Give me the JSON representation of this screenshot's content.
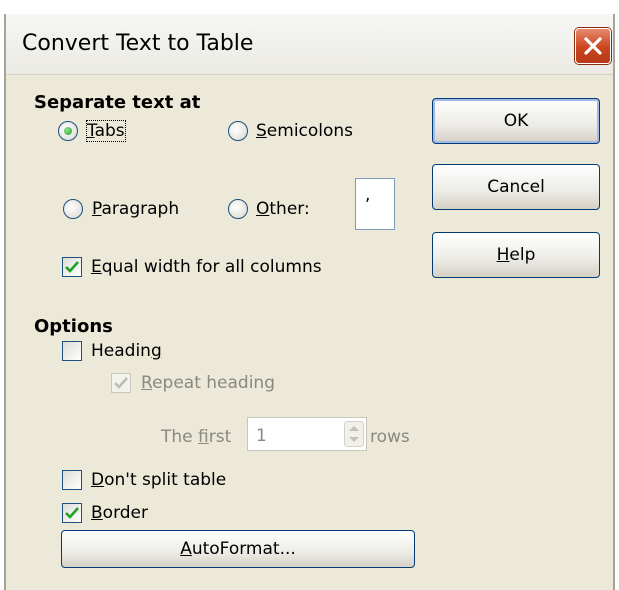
{
  "dialog": {
    "title": "Convert Text to Table"
  },
  "separate": {
    "group_title": "Separate text at",
    "tabs": {
      "label": "Tabs",
      "selected": true
    },
    "semicolons": {
      "label": "Semicolons",
      "selected": false
    },
    "paragraph": {
      "label": "Paragraph",
      "selected": false
    },
    "other": {
      "label": "Other:",
      "selected": false,
      "value": ","
    },
    "equal_width": {
      "label": "Equal width for all columns",
      "checked": true
    }
  },
  "buttons": {
    "ok": "OK",
    "cancel": "Cancel",
    "help": "Help"
  },
  "options": {
    "group_title": "Options",
    "heading": {
      "label": "Heading",
      "checked": false
    },
    "repeat_heading": {
      "label": "Repeat heading",
      "checked": true,
      "enabled": false
    },
    "first_rows": {
      "prefix": "The first",
      "value": "1",
      "suffix": "rows",
      "enabled": false
    },
    "dont_split": {
      "label": "Don't split table",
      "checked": false
    },
    "border": {
      "label": "Border",
      "checked": true
    },
    "autoformat": "AutoFormat..."
  },
  "icons": {
    "close": "close-icon",
    "check": "checkmark-icon",
    "spin": "spin-arrows-icon"
  },
  "colors": {
    "dialog_bg": "#ece9d8",
    "close_red": "#c9451f",
    "radio_dot": "#21a121",
    "check_green": "#21a121",
    "disabled_text": "#8a887f"
  }
}
